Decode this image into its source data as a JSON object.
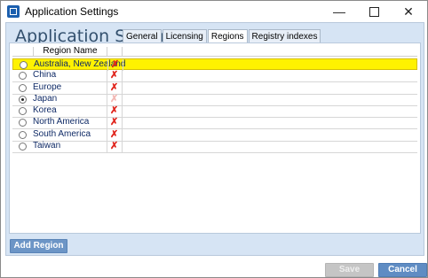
{
  "window": {
    "title": "Application Settings",
    "minimize_glyph": "—",
    "close_glyph": "✕"
  },
  "page": {
    "heading": "Application Settings"
  },
  "tabs": [
    {
      "label": "General"
    },
    {
      "label": "Licensing"
    },
    {
      "label": "Regions"
    },
    {
      "label": "Registry indexes"
    }
  ],
  "active_tab": "Regions",
  "grid": {
    "column_header": "Region Name",
    "delete_glyph": "✗",
    "rows": [
      {
        "name": "Australia, New Zealand",
        "selected": false,
        "highlighted": true,
        "delete_enabled": true
      },
      {
        "name": "China",
        "selected": false,
        "highlighted": false,
        "delete_enabled": true
      },
      {
        "name": "Europe",
        "selected": false,
        "highlighted": false,
        "delete_enabled": true
      },
      {
        "name": "Japan",
        "selected": true,
        "highlighted": false,
        "delete_enabled": false
      },
      {
        "name": "Korea",
        "selected": false,
        "highlighted": false,
        "delete_enabled": true
      },
      {
        "name": "North America",
        "selected": false,
        "highlighted": false,
        "delete_enabled": true
      },
      {
        "name": "South America",
        "selected": false,
        "highlighted": false,
        "delete_enabled": true
      },
      {
        "name": "Taiwan",
        "selected": false,
        "highlighted": false,
        "delete_enabled": true
      }
    ]
  },
  "buttons": {
    "add_region": "Add Region",
    "save": "Save",
    "cancel": "Cancel"
  },
  "colors": {
    "highlight_row": "#fff200",
    "delete_icon": "#e0241c",
    "primary_button": "#5f8cc3"
  }
}
